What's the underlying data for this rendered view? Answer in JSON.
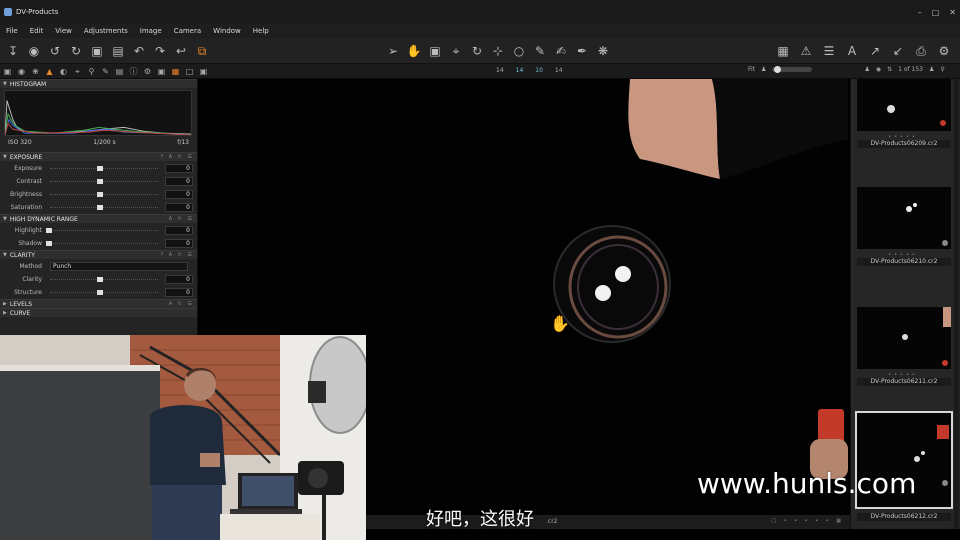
{
  "window": {
    "title": "DV-Products"
  },
  "menu": [
    "File",
    "Edit",
    "View",
    "Adjustments",
    "Image",
    "Camera",
    "Window",
    "Help"
  ],
  "subtoolbar": {
    "nums": [
      "14",
      "14",
      "10",
      "14"
    ],
    "fit_label": "Fit",
    "count": "1 of 153"
  },
  "histogram": {
    "title": "HISTOGRAM",
    "iso": "ISO 320",
    "shutter": "1/200 s",
    "aperture": "f/13"
  },
  "exposure": {
    "title": "EXPOSURE",
    "rows": [
      {
        "label": "Exposure",
        "value": "0"
      },
      {
        "label": "Contrast",
        "value": "0"
      },
      {
        "label": "Brightness",
        "value": "0"
      },
      {
        "label": "Saturation",
        "value": "0"
      }
    ]
  },
  "hdr": {
    "title": "HIGH DYNAMIC RANGE",
    "rows": [
      {
        "label": "Highlight",
        "value": "0"
      },
      {
        "label": "Shadow",
        "value": "0"
      }
    ]
  },
  "clarity": {
    "title": "CLARITY",
    "method_label": "Method",
    "method_value": "Punch",
    "rows": [
      {
        "label": "Clarity",
        "value": "0"
      },
      {
        "label": "Structure",
        "value": "0"
      }
    ]
  },
  "levels": {
    "title": "LEVELS"
  },
  "curve": {
    "title": "CURVE"
  },
  "filmstrip": [
    "DV-Products06209.cr2",
    "DV-Products06210.cr2",
    "DV-Products06211.cr2",
    "DV-Products06212.cr2"
  ],
  "bottombar": {
    "filename": ".cr2"
  },
  "subtitle": "好吧，这很好",
  "watermark": "www.hunls.com",
  "colors": {
    "accent": "#e8832a",
    "panel": "#242424",
    "viewer_bg": "#020202"
  }
}
